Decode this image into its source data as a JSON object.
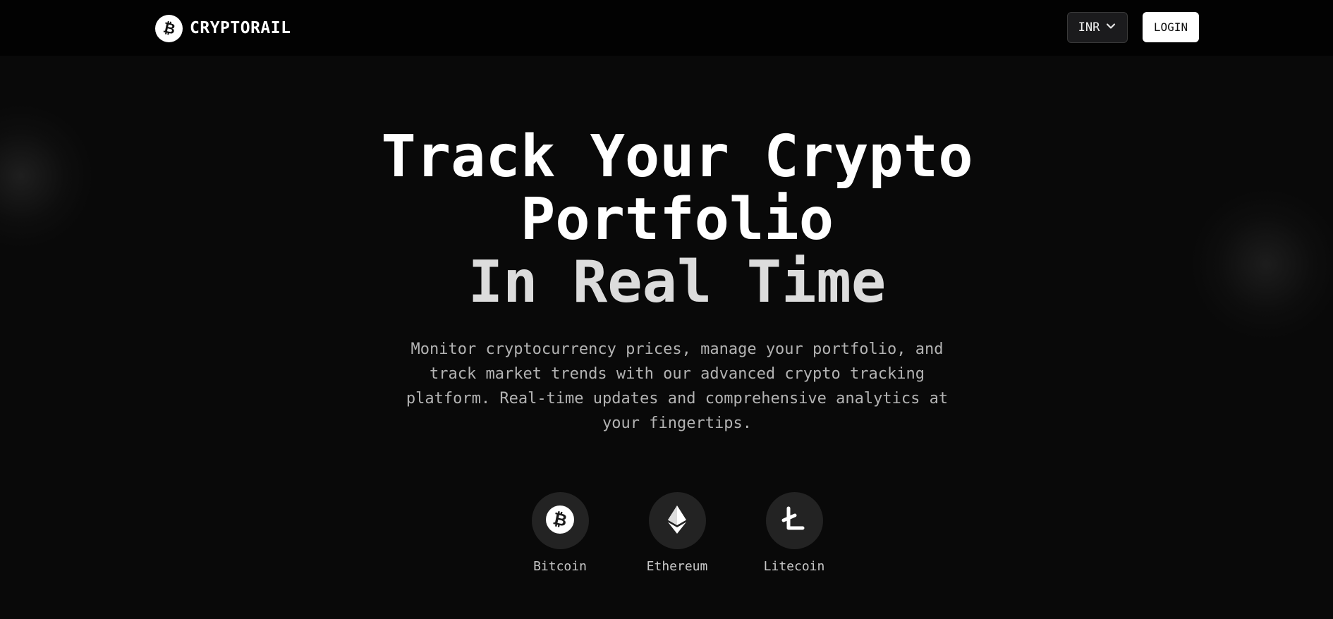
{
  "header": {
    "brand_name": "CRYPTORAIL",
    "brand_icon": "bitcoin-logo-icon",
    "currency": {
      "selected": "INR",
      "icon": "chevron-down-icon"
    },
    "login_label": "LOGIN"
  },
  "hero": {
    "title_line_1": "Track Your Crypto",
    "title_line_2": "Portfolio",
    "title_line_3": "In Real Time",
    "subtitle": "Monitor cryptocurrency prices, manage your portfolio, and track market trends with our advanced crypto tracking platform. Real-time updates and comprehensive analytics at your fingertips."
  },
  "coins": [
    {
      "label": "Bitcoin",
      "icon": "bitcoin-icon"
    },
    {
      "label": "Ethereum",
      "icon": "ethereum-icon"
    },
    {
      "label": "Litecoin",
      "icon": "litecoin-icon"
    }
  ],
  "colors": {
    "background": "#090909",
    "header_background": "#020202",
    "accent": "#ffffff",
    "muted_text": "#b3b3b3",
    "coin_circle": "#232323"
  }
}
